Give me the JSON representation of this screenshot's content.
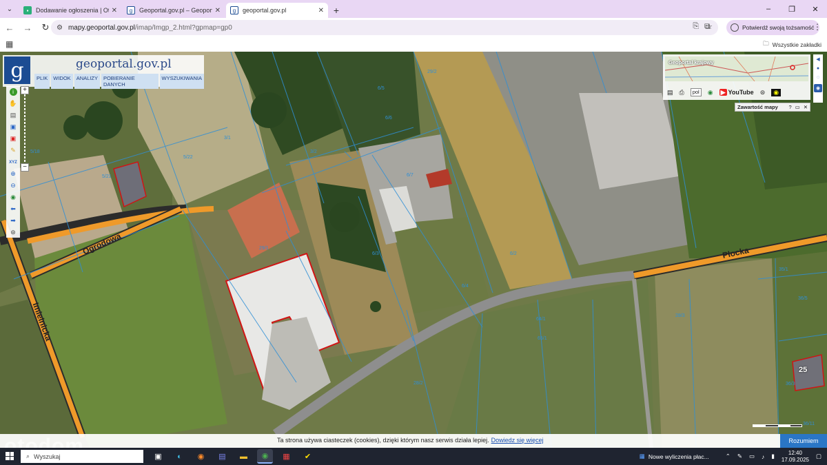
{
  "browser": {
    "tabs": [
      {
        "title": "Dodawanie ogłoszenia | Otodo",
        "icon": "otodom-favicon",
        "color": "#2bb07a",
        "active": false
      },
      {
        "title": "Geoportal.gov.pl – Geoportal In",
        "icon": "geoportal-favicon",
        "color": "#1c4c93",
        "active": false
      },
      {
        "title": "geoportal.gov.pl",
        "icon": "geoportal-favicon",
        "color": "#1c4c93",
        "active": true
      }
    ],
    "url_host": "mapy.geoportal.gov.pl",
    "url_path": "/imap/Imgp_2.html?gpmap=gp0",
    "identity_button": "Potwierdź swoją tożsamość",
    "all_bookmarks": "Wszystkie zakładki"
  },
  "geoportal": {
    "title": "geoportal.gov.pl",
    "logo_letter": "g",
    "menu": [
      "PLIK",
      "WIDOK",
      "ANALIZY",
      "POBIERANIE DANYCH",
      "WYSZUKIWANIA"
    ],
    "tools": [
      "info-icon",
      "pan-icon",
      "layers-icon",
      "select-area-icon",
      "select-remove-icon",
      "measure-icon",
      "xyz-icon",
      "zoom-in-icon",
      "zoom-out-icon",
      "globe-icon",
      "back-arrow-icon",
      "forward-arrow-icon",
      "locate-icon"
    ],
    "xyz_label": "XYZ",
    "overview_label": "Geoportal krajowy",
    "language": "pol",
    "youtube_label": "YouTube",
    "content_panel": "Zawartość mapy",
    "content_panel_controls": [
      "?",
      "▭",
      "✕"
    ],
    "road_labels": {
      "ogrodowa": "Ogrodowa",
      "imielnicka": "Imielnicka",
      "plocka": "Płocka"
    },
    "address_number": "25",
    "parcel_labels": [
      "5/20",
      "5/21",
      "5/18",
      "5/22",
      "3/1",
      "3/2",
      "6/5",
      "6/6",
      "6/7",
      "6/3",
      "6/4",
      "6/2",
      "64/1",
      "65/1",
      "28/2",
      "28/3",
      "29/1",
      "29/2",
      "35/1",
      "36/5",
      "36/3",
      "36/11"
    ]
  },
  "cookie": {
    "text": "Ta strona używa ciasteczek (cookies), dzięki którym nasz serwis działa lepiej.",
    "link": "Dowiedz się więcej",
    "button": "Rozumiem"
  },
  "watermark": "otodom",
  "taskbar": {
    "search_placeholder": "Wyszukaj",
    "apps": [
      "task-view-icon",
      "edge-icon",
      "firefox-icon",
      "teams-icon",
      "file-explorer-icon",
      "chrome-icon",
      "store-icon",
      "check-app-icon"
    ],
    "news": "Nowe wyliczenia płac...",
    "time": "12:40",
    "date": "17.09.2025"
  }
}
